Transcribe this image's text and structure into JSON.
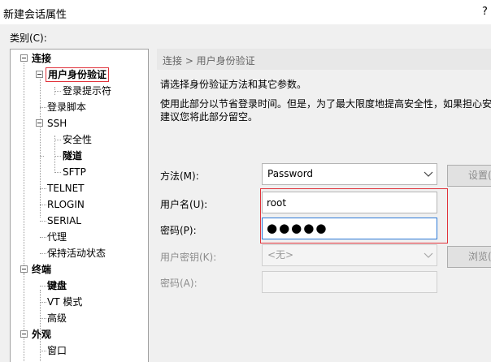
{
  "window": {
    "title": "新建会话属性",
    "help": "?"
  },
  "category_label": "类别(C):",
  "tree": {
    "connection": "连接",
    "user_auth": "用户身份验证",
    "login_prompt": "登录提示符",
    "login_script": "登录脚本",
    "ssh": "SSH",
    "security": "安全性",
    "tunnel": "隧道",
    "sftp": "SFTP",
    "telnet": "TELNET",
    "rlogin": "RLOGIN",
    "serial": "SERIAL",
    "proxy": "代理",
    "keepalive": "保持活动状态",
    "terminal": "终端",
    "keyboard": "键盘",
    "vt_mode": "VT 模式",
    "advanced": "高级",
    "appearance": "外观",
    "window": "窗口"
  },
  "breadcrumb": "连接 > 用户身份验证",
  "description": {
    "line1": "请选择身份验证方法和其它参数。",
    "line2": "使用此部分以节省登录时间。但是，为了最大限度地提高安全性，如果担心安",
    "line3": "建议您将此部分留空。"
  },
  "form": {
    "method_label": "方法(M):",
    "method_value": "Password",
    "settings_button": "设置(",
    "username_label": "用户名(U):",
    "username_value": "root",
    "password_label": "密码(P):",
    "password_value": "●●●●●",
    "userkey_label": "用户密钥(K):",
    "userkey_value": "<无>",
    "browse_button": "浏览(",
    "passphrase_label": "密码(A):",
    "passphrase_value": ""
  },
  "colors": {
    "highlight": "#e0323a",
    "focus": "#2b79d7"
  }
}
